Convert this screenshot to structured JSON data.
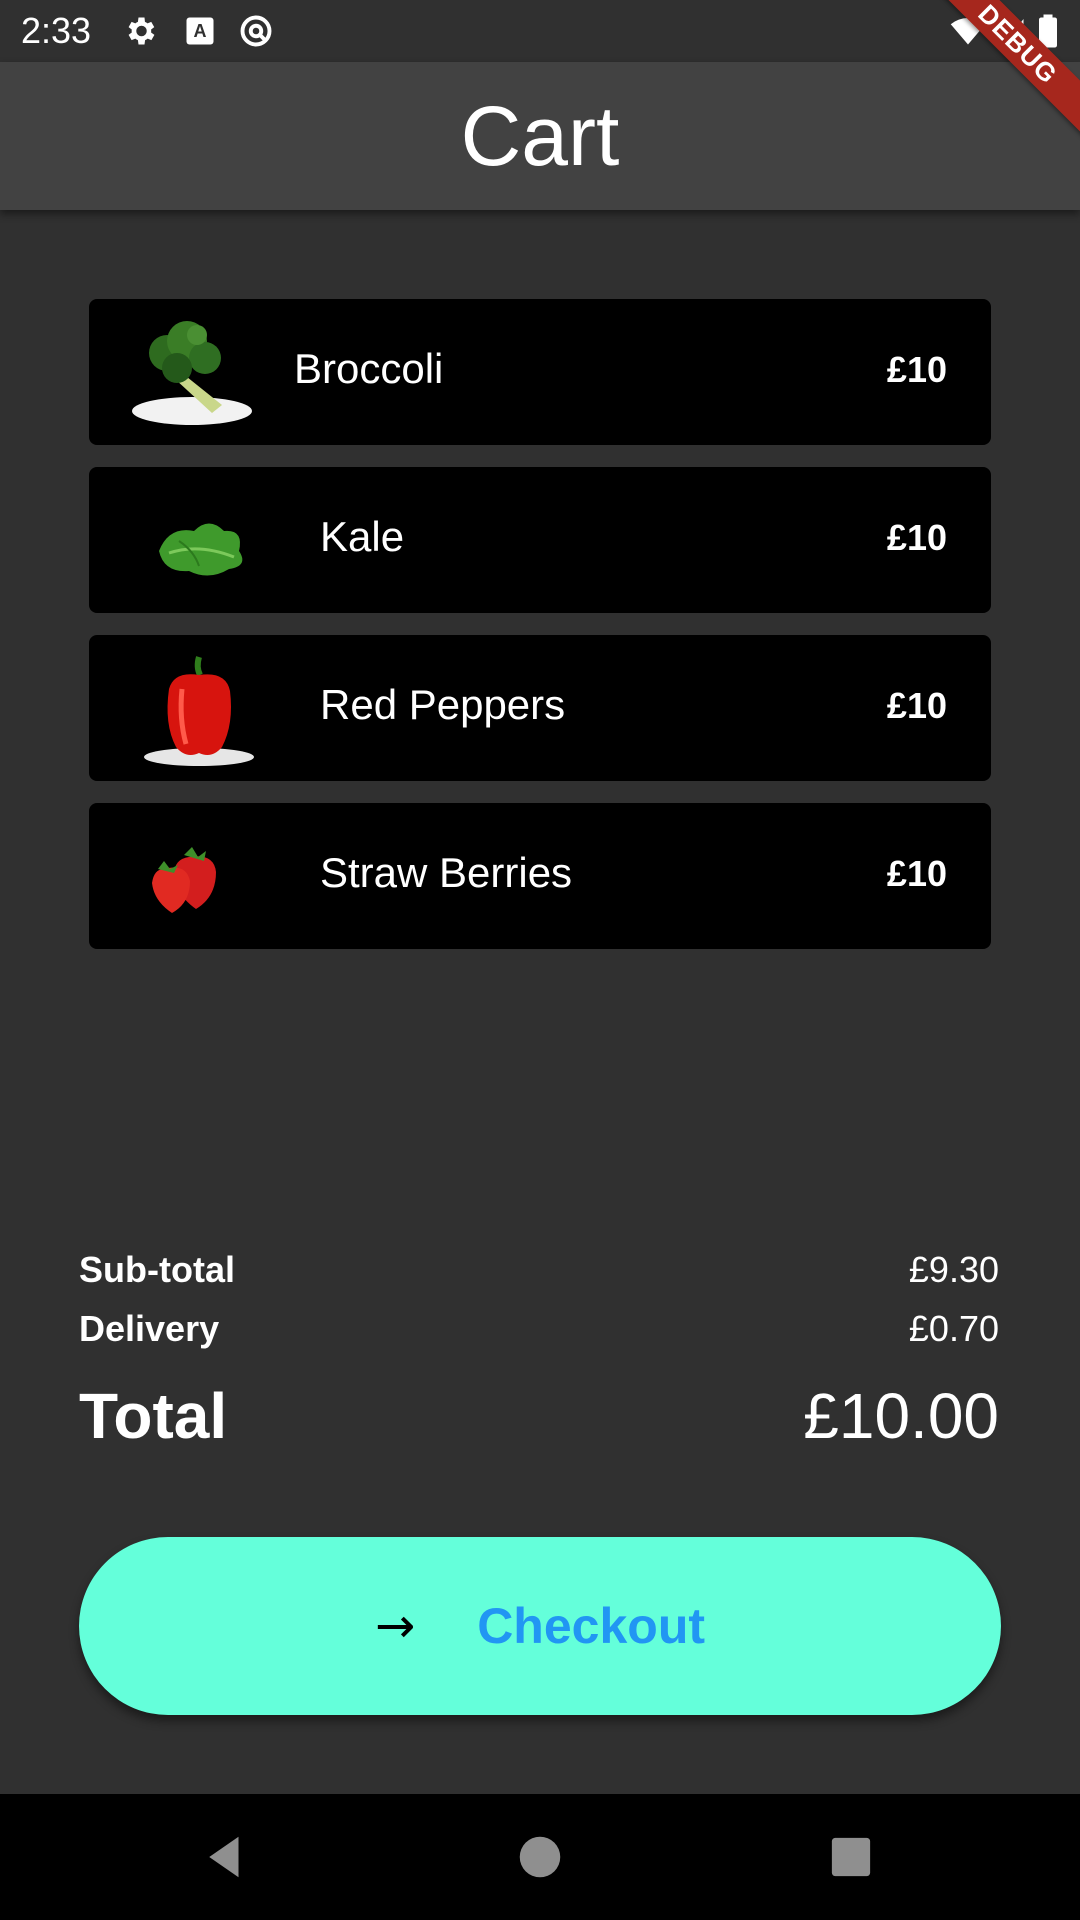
{
  "status_bar": {
    "time": "2:33",
    "icons": [
      "gear-icon",
      "a-icon",
      "at-icon",
      "wifi-icon",
      "signal-icon",
      "battery-icon"
    ]
  },
  "debug_ribbon": "DEBUG",
  "app_bar": {
    "title": "Cart"
  },
  "cart": {
    "items": [
      {
        "name": "Broccoli",
        "price": "£10",
        "image": "broccoli-image"
      },
      {
        "name": "Kale",
        "price": "£10",
        "image": "kale-image"
      },
      {
        "name": "Red Peppers",
        "price": "£10",
        "image": "red-pepper-image"
      },
      {
        "name": "Straw Berries",
        "price": "£10",
        "image": "strawberry-image"
      }
    ]
  },
  "summary": {
    "subtotal_label": "Sub-total",
    "subtotal_value": "£9.30",
    "delivery_label": "Delivery",
    "delivery_value": "£0.70",
    "total_label": "Total",
    "total_value": "£10.00"
  },
  "checkout": {
    "label": "Checkout",
    "icon": "arrow-right-icon",
    "arrow": "→"
  },
  "colors": {
    "accent": "#64ffda",
    "button_text": "#2196f3",
    "background": "#303030",
    "app_bar": "#424242",
    "card": "#000000",
    "debug": "#a6271d"
  },
  "nav_bar": {
    "buttons": [
      "back-icon",
      "home-icon",
      "recents-icon"
    ]
  }
}
